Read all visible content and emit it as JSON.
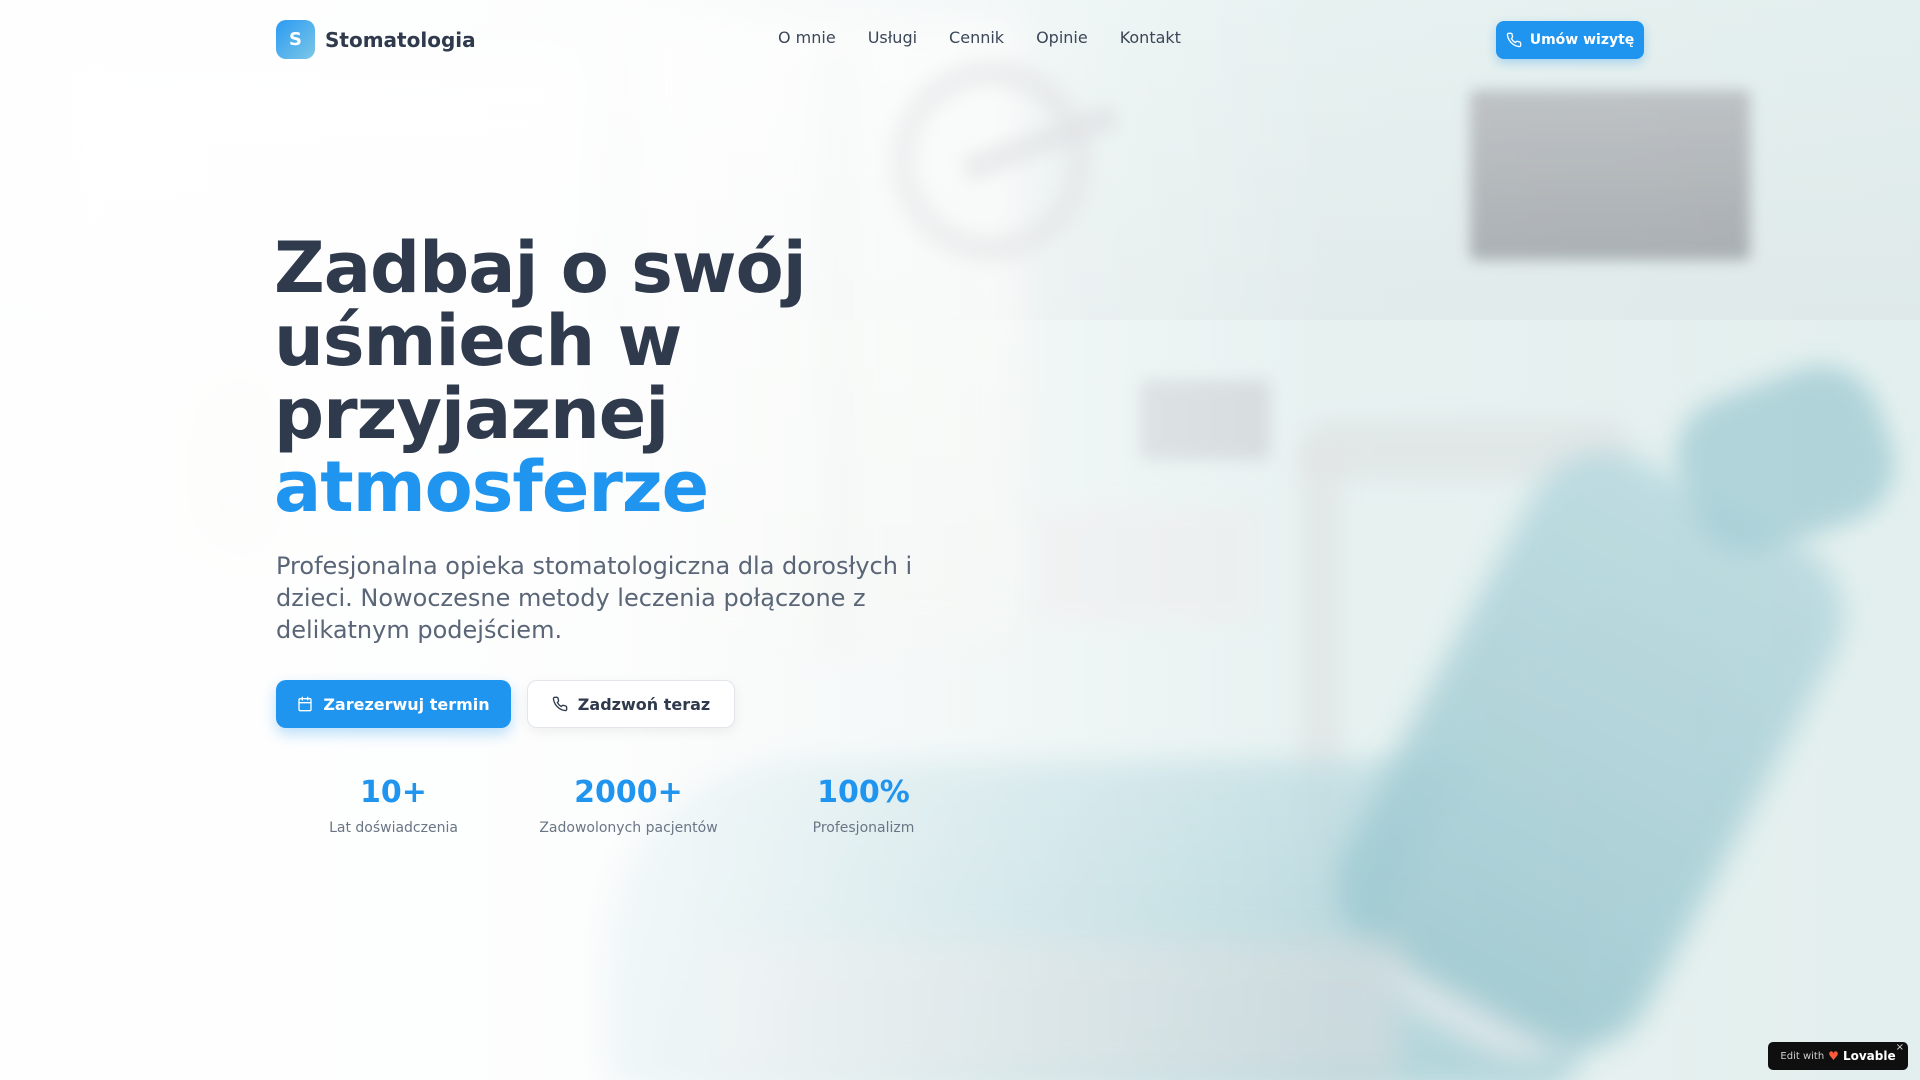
{
  "brand": {
    "logo_letter": "S",
    "name": "Stomatologia"
  },
  "nav": {
    "items": [
      "O mnie",
      "Usługi",
      "Cennik",
      "Opinie",
      "Kontakt"
    ],
    "cta_label": "Umów wizytę"
  },
  "hero": {
    "title_lines": [
      "Zadbaj o swój",
      "uśmiech w",
      "przyjaznej"
    ],
    "title_accent": "atmosferze",
    "subtitle": "Profesjonalna opieka stomatologiczna dla dorosłych i dzieci. Nowoczesne metody leczenia połączone z delikatnym podejściem.",
    "primary_button": "Zarezerwuj termin",
    "secondary_button": "Zadzwoń teraz"
  },
  "stats": [
    {
      "value": "10+",
      "label": "Lat doświadczenia"
    },
    {
      "value": "2000+",
      "label": "Zadowolonych pacjentów"
    },
    {
      "value": "100%",
      "label": "Profesjonalizm"
    }
  ],
  "badge": {
    "prefix": "Edit with",
    "name": "Lovable",
    "close": "×"
  },
  "icons": {
    "phone": "phone-icon",
    "calendar": "calendar-icon",
    "heart": "lovable-heart-icon"
  },
  "colors": {
    "accent": "#1f95f0",
    "heading": "#2f3a4c",
    "body": "#5a6677"
  }
}
